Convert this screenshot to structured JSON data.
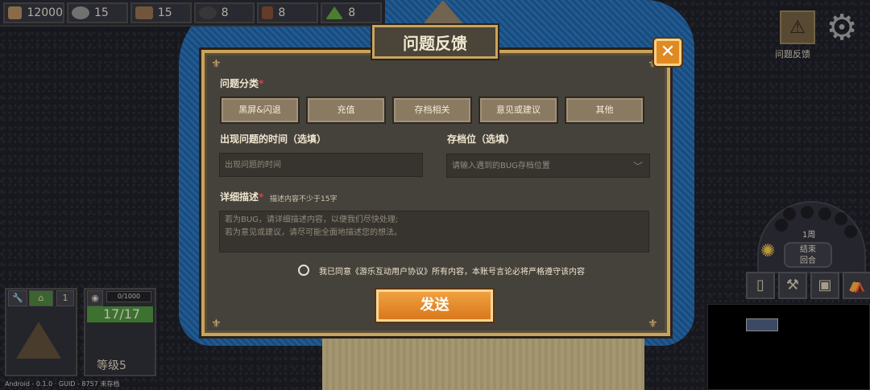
{
  "resources": [
    {
      "icon": "wood-icon",
      "value": "12000",
      "color": "#a8835a"
    },
    {
      "icon": "stone-icon",
      "value": "15",
      "color": "#8a8a8a"
    },
    {
      "icon": "timber-icon",
      "value": "15",
      "color": "#8c6a48"
    },
    {
      "icon": "pot-icon",
      "value": "8",
      "color": "#444"
    },
    {
      "icon": "pillar-icon",
      "value": "8",
      "color": "#7a4a32"
    },
    {
      "icon": "grass-icon",
      "value": "8",
      "color": "#5f9a3a"
    }
  ],
  "right_panel": {
    "feedback_label": "问题反馈",
    "week": "1周",
    "end_round_line1": "结束",
    "end_round_line2": "回合"
  },
  "card": {
    "hp": "0/1000",
    "count": "17/17",
    "level": "等级5"
  },
  "hud_left": {
    "num": "1"
  },
  "footer": "Android - 0.1.0 · GUID - 8757   未存档",
  "dialog": {
    "title": "问题反馈",
    "category_label": "问题分类",
    "categories": [
      "黑屏&闪退",
      "充值",
      "存档相关",
      "意见或建议",
      "其他"
    ],
    "time_label": "出现问题的时间（选填）",
    "time_placeholder": "出现问题的时间",
    "slot_label": "存档位（选填）",
    "slot_placeholder": "请输入遇到的BUG存档位置",
    "detail_label": "详细描述",
    "detail_hint": "描述内容不少于15字",
    "detail_placeholder_1": "若为BUG，请详细描述内容，以便我们尽快处理;",
    "detail_placeholder_2": "若为意见或建议，请尽可能全面地描述您的想法。",
    "agree_text": "我已同意《游乐互动用户协议》所有内容，本账号言论必将严格遵守该内容",
    "send": "发送"
  },
  "accent_color": "#e08a22"
}
